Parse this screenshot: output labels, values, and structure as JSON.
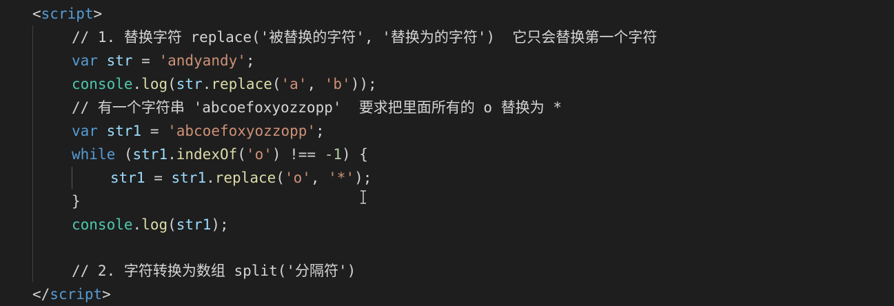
{
  "editor": {
    "lines": [
      {
        "indent": "",
        "tokens": [
          {
            "t": "<",
            "c": "punc"
          },
          {
            "t": "script",
            "c": "tag"
          },
          {
            "t": ">",
            "c": "punc"
          }
        ]
      },
      {
        "indent": "    ",
        "tokens": [
          {
            "t": "// 1. 替换字符 replace('被替换的字符', '替换为的字符')  它只会替换第一个字符",
            "c": "comment"
          }
        ]
      },
      {
        "indent": "    ",
        "tokens": [
          {
            "t": "var",
            "c": "kw"
          },
          {
            "t": " ",
            "c": "punc"
          },
          {
            "t": "str",
            "c": "var"
          },
          {
            "t": " = ",
            "c": "punc"
          },
          {
            "t": "'andyandy'",
            "c": "str"
          },
          {
            "t": ";",
            "c": "punc"
          }
        ]
      },
      {
        "indent": "    ",
        "tokens": [
          {
            "t": "console",
            "c": "obj"
          },
          {
            "t": ".",
            "c": "punc"
          },
          {
            "t": "log",
            "c": "fn"
          },
          {
            "t": "(",
            "c": "punc"
          },
          {
            "t": "str",
            "c": "var"
          },
          {
            "t": ".",
            "c": "punc"
          },
          {
            "t": "replace",
            "c": "fn"
          },
          {
            "t": "(",
            "c": "punc"
          },
          {
            "t": "'a'",
            "c": "str"
          },
          {
            "t": ", ",
            "c": "punc"
          },
          {
            "t": "'b'",
            "c": "str"
          },
          {
            "t": "));",
            "c": "punc"
          }
        ]
      },
      {
        "indent": "    ",
        "tokens": [
          {
            "t": "// 有一个字符串 'abcoefoxyozzopp'  要求把里面所有的 o 替换为 *",
            "c": "comment"
          }
        ]
      },
      {
        "indent": "    ",
        "tokens": [
          {
            "t": "var",
            "c": "kw"
          },
          {
            "t": " ",
            "c": "punc"
          },
          {
            "t": "str1",
            "c": "var"
          },
          {
            "t": " = ",
            "c": "punc"
          },
          {
            "t": "'abcoefoxyozzopp'",
            "c": "str"
          },
          {
            "t": ";",
            "c": "punc"
          }
        ]
      },
      {
        "indent": "    ",
        "tokens": [
          {
            "t": "while",
            "c": "kw"
          },
          {
            "t": " (",
            "c": "punc"
          },
          {
            "t": "str1",
            "c": "var"
          },
          {
            "t": ".",
            "c": "punc"
          },
          {
            "t": "indexOf",
            "c": "fn"
          },
          {
            "t": "(",
            "c": "punc"
          },
          {
            "t": "'o'",
            "c": "str"
          },
          {
            "t": ") !== ",
            "c": "punc"
          },
          {
            "t": "-1",
            "c": "num"
          },
          {
            "t": ") {",
            "c": "punc"
          }
        ]
      },
      {
        "indent": "        ",
        "tokens": [
          {
            "t": "str1",
            "c": "var"
          },
          {
            "t": " = ",
            "c": "punc"
          },
          {
            "t": "str1",
            "c": "var"
          },
          {
            "t": ".",
            "c": "punc"
          },
          {
            "t": "replace",
            "c": "fn"
          },
          {
            "t": "(",
            "c": "punc"
          },
          {
            "t": "'o'",
            "c": "str"
          },
          {
            "t": ", ",
            "c": "punc"
          },
          {
            "t": "'*'",
            "c": "str"
          },
          {
            "t": ");",
            "c": "punc"
          }
        ]
      },
      {
        "indent": "    ",
        "tokens": [
          {
            "t": "}",
            "c": "punc"
          }
        ]
      },
      {
        "indent": "    ",
        "tokens": [
          {
            "t": "console",
            "c": "obj"
          },
          {
            "t": ".",
            "c": "punc"
          },
          {
            "t": "log",
            "c": "fn"
          },
          {
            "t": "(",
            "c": "punc"
          },
          {
            "t": "str1",
            "c": "var"
          },
          {
            "t": ");",
            "c": "punc"
          }
        ]
      },
      {
        "indent": "",
        "tokens": []
      },
      {
        "indent": "    ",
        "tokens": [
          {
            "t": "// 2. 字符转换为数组 split('分隔符')",
            "c": "comment"
          }
        ]
      },
      {
        "indent": "",
        "tokens": [
          {
            "t": "</",
            "c": "punc"
          },
          {
            "t": "script",
            "c": "tag"
          },
          {
            "t": ">",
            "c": "punc"
          }
        ]
      }
    ]
  }
}
